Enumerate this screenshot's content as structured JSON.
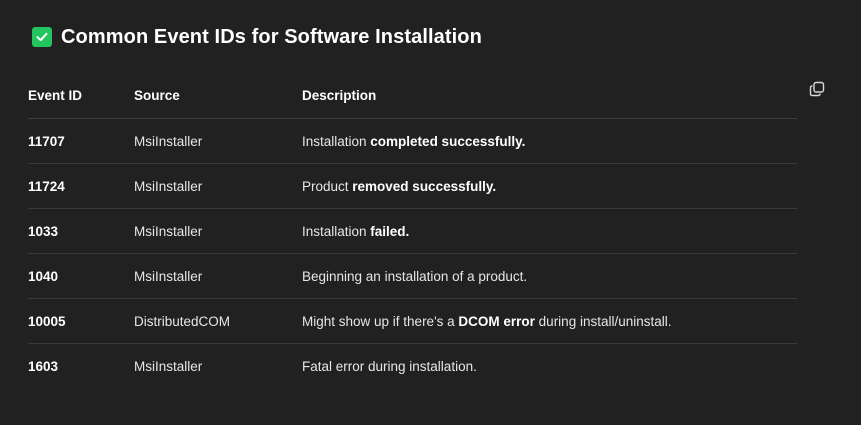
{
  "heading": {
    "icon": "check-box-icon",
    "icon_color": "#22c55e",
    "title": "Common Event IDs for Software Installation"
  },
  "copy_button": {
    "icon": "copy-icon"
  },
  "table": {
    "headers": [
      "Event ID",
      "Source",
      "Description"
    ],
    "rows": [
      {
        "id": "11707",
        "source": "MsiInstaller",
        "desc": [
          {
            "t": "Installation "
          },
          {
            "t": "completed successfully.",
            "b": true
          }
        ]
      },
      {
        "id": "11724",
        "source": "MsiInstaller",
        "desc": [
          {
            "t": "Product "
          },
          {
            "t": "removed successfully.",
            "b": true
          }
        ]
      },
      {
        "id": "1033",
        "source": "MsiInstaller",
        "desc": [
          {
            "t": "Installation "
          },
          {
            "t": "failed.",
            "b": true
          }
        ]
      },
      {
        "id": "1040",
        "source": "MsiInstaller",
        "desc": [
          {
            "t": "Beginning an installation of a product."
          }
        ]
      },
      {
        "id": "10005",
        "source": "DistributedCOM",
        "desc": [
          {
            "t": "Might show up if there's a "
          },
          {
            "t": "DCOM error",
            "b": true
          },
          {
            "t": " during install/uninstall."
          }
        ]
      },
      {
        "id": "1603",
        "source": "MsiInstaller",
        "desc": [
          {
            "t": "Fatal error during installation."
          }
        ]
      }
    ]
  }
}
